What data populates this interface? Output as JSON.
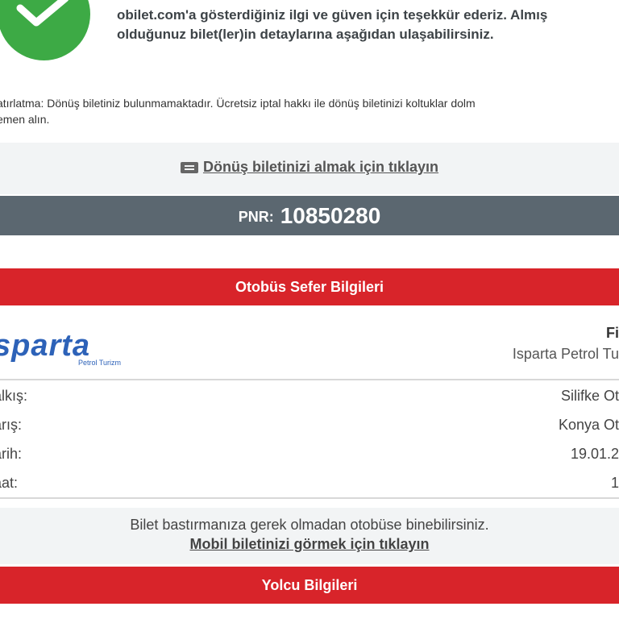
{
  "success": {
    "message_line1": "obilet.com'a gösterdiğiniz ilgi ve güven için teşekkür ederiz. Almış",
    "message_line2": "olduğunuz bilet(ler)in detaylarına aşağıdan ulaşabilirsiniz.",
    "icon": "check-icon",
    "color": "#3daa45"
  },
  "reminder": {
    "line1": "atırlatma: Dönüş biletiniz bulunmamaktadır. Ücretsiz iptal hakkı ile dönüş biletinizi koltuklar dolm",
    "line2": "emen alın."
  },
  "return_ticket": {
    "link_text": "Dönüş biletinizi almak için tıklayın",
    "icon": "ticket-icon"
  },
  "pnr": {
    "label": "PNR:",
    "value": "10850280"
  },
  "sections": {
    "trip_header": "Otobüs Sefer Bilgileri",
    "passenger_header": "Yolcu Bilgileri"
  },
  "company": {
    "logo_text": "sparta",
    "logo_sub": "Petrol Turizm",
    "short_name": "Fi",
    "full_name": "Isparta Petrol Tu"
  },
  "trip": {
    "departure_label": "alkış:",
    "departure_value": "Silifke Ot",
    "arrival_label": "arış:",
    "arrival_value": "Konya Ot",
    "date_label": "arih:",
    "date_value": "19.01.2",
    "time_label": "aat:",
    "time_value": "1"
  },
  "mobile": {
    "text": "Bilet bastırmanıza gerek olmadan otobüse binebilirsiniz.",
    "link_text": "Mobil biletinizi görmek için tıklayın"
  },
  "colors": {
    "red": "#d8242a",
    "pnr_bg": "#5b6770",
    "light_bg": "#f2f4f5",
    "logo_blue": "#2d62b8"
  }
}
